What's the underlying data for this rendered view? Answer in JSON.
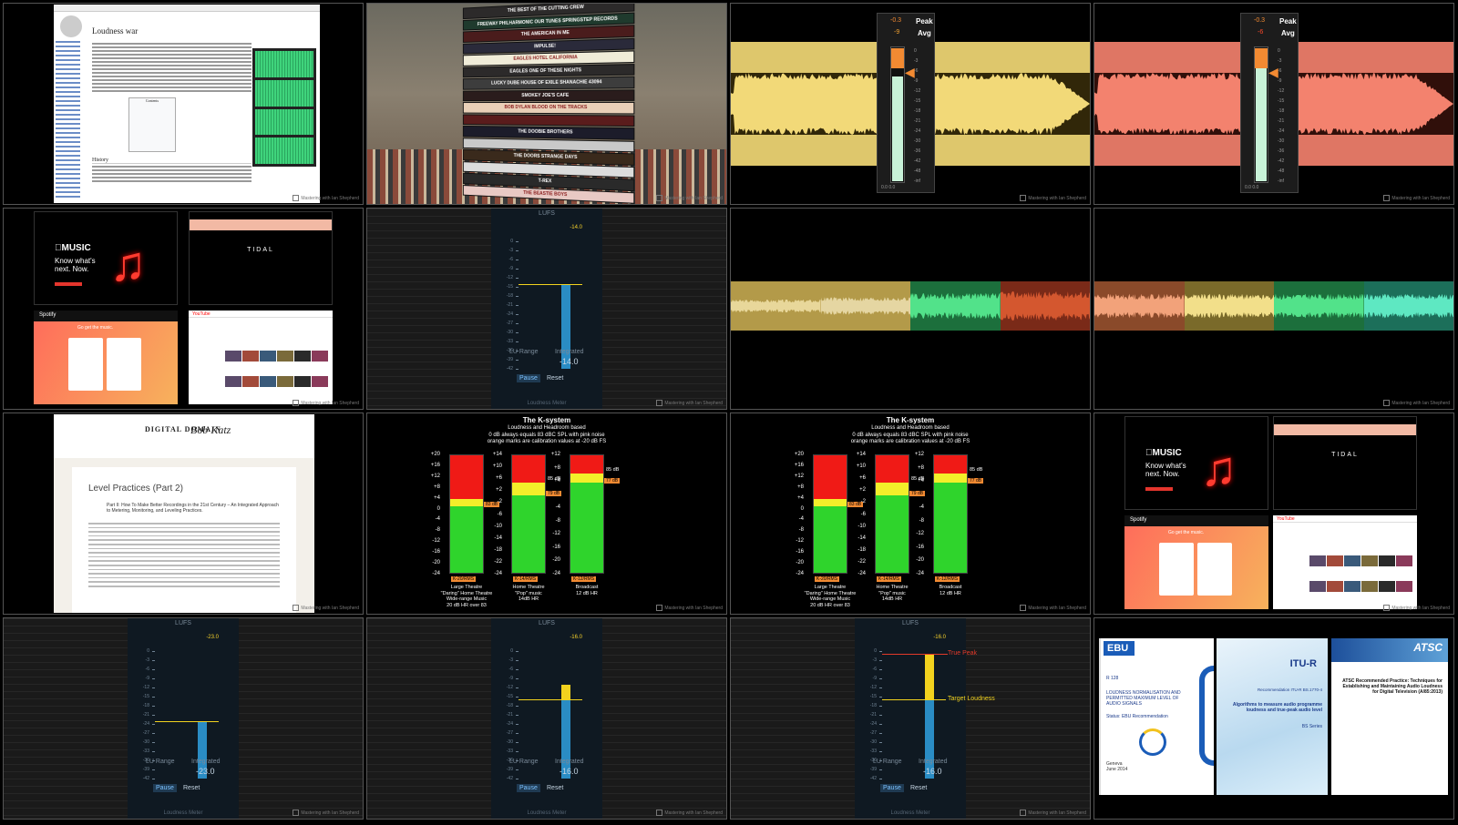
{
  "tiles": {
    "wiki": {
      "title": "Loudness war",
      "history_heading": "History",
      "contents_label": "Contents"
    },
    "cd": {
      "cases": [
        "THE BEST OF THE CUTTING CREW",
        "FREEWAY PHILHARMONIC   OUR TUNES   SPRINGSTEP RECORDS",
        "THE AMERICAN IN ME",
        "IMPULSE!",
        "EAGLES   HOTEL CALIFORNIA",
        "EAGLES   ONE OF THESE NIGHTS",
        "LUCKY DUBE   HOUSE OF EXILE   SHANACHIE 43094",
        "SMOKEY JOE'S CAFE",
        "BOB DYLAN   BLOOD ON THE TRACKS",
        "",
        "THE DOOBIE BROTHERS",
        "",
        "THE DOORS   STRANGE DAYS",
        "",
        "T-REX",
        "THE BEASTIE BOYS"
      ]
    },
    "meter_a": {
      "peak_label": "Peak",
      "avg_label": "Avg",
      "peak_value": "-0.3",
      "avg_value": "-9",
      "scale": [
        "0",
        "-3",
        "-6",
        "-9",
        "-12",
        "-15",
        "-18",
        "-21",
        "-24",
        "-30",
        "-36",
        "-42",
        "-48",
        "-inf"
      ],
      "readout": "0.0   0.0",
      "wave_color": "#f2d978",
      "wave_dark": "#8c6f1a",
      "level": 0.78
    },
    "meter_b": {
      "peak_label": "Peak",
      "avg_label": "Avg",
      "peak_value": "-0.3",
      "avg_value": "-6",
      "scale": [
        "0",
        "-3",
        "-6",
        "-9",
        "-12",
        "-15",
        "-18",
        "-21",
        "-24",
        "-30",
        "-36",
        "-42",
        "-48",
        "-inf"
      ],
      "readout": "0.0   0.0",
      "wave_color": "#f3826e",
      "wave_dark": "#8a2a1e",
      "level": 0.84
    },
    "logos": {
      "apple_line1": "MUSIC",
      "apple_line2": "Know what's next. Now.",
      "tidal": "TIDAL",
      "spotify": "Spotify",
      "spotify_tag": "Go get the music.",
      "youtube": "YouTube"
    },
    "lufs_14": {
      "title": "LUFS",
      "max": "-14.0",
      "lu_range": "LU Range",
      "integrated": "Integrated",
      "integrated_value": "-14.0",
      "pause": "Pause",
      "reset": "Reset",
      "footer": "Loudness Meter",
      "scale": [
        "0",
        "-3",
        "-6",
        "-9",
        "-12",
        "-15",
        "-18",
        "-21",
        "-24",
        "-27",
        "-30",
        "-33",
        "-36",
        "-39",
        "-42"
      ]
    },
    "lufs_23": {
      "title": "LUFS",
      "max": "-23.0",
      "lu_range": "LU Range",
      "integrated": "Integrated",
      "integrated_value": "-23.0",
      "pause": "Pause",
      "reset": "Reset",
      "footer": "Loudness Meter",
      "scale": [
        "0",
        "-3",
        "-6",
        "-9",
        "-12",
        "-15",
        "-18",
        "-21",
        "-24",
        "-27",
        "-30",
        "-33",
        "-36",
        "-39",
        "-42"
      ]
    },
    "lufs_16a": {
      "title": "LUFS",
      "max": "-16.0",
      "lu_range": "LU Range",
      "integrated": "Integrated",
      "integrated_value": "-16.0",
      "pause": "Pause",
      "reset": "Reset",
      "footer": "Loudness Meter",
      "scale": [
        "0",
        "-3",
        "-6",
        "-9",
        "-12",
        "-15",
        "-18",
        "-21",
        "-24",
        "-27",
        "-30",
        "-33",
        "-36",
        "-39",
        "-42"
      ]
    },
    "lufs_16b": {
      "title": "LUFS",
      "max": "-16.0",
      "lu_range": "LU Range",
      "integrated": "Integrated",
      "integrated_value": "-16.0",
      "pause": "Pause",
      "reset": "Reset",
      "footer": "Loudness Meter",
      "true_peak": "True Peak",
      "target": "Target Loudness",
      "scale": [
        "0",
        "-3",
        "-6",
        "-9",
        "-12",
        "-15",
        "-18",
        "-21",
        "-24",
        "-27",
        "-30",
        "-33",
        "-36",
        "-39",
        "-42"
      ]
    },
    "doc": {
      "brand": "DIGITAL DOMAIN",
      "signature": "Bob Katz",
      "heading": "Level Practices (Part 2)",
      "subheading": "Part II: How To Make Better Recordings in the 21st Century – An Integrated Approach to Metering, Monitoring, and Leveling Practices."
    },
    "ksystem": {
      "title": "The K-system",
      "line1": "Loudness and Headroom based",
      "line2": "0 dB always equals 83 dBC SPL with pink noise",
      "line3": "orange marks are calibration values at -20 dB FS",
      "scale20": [
        "+20",
        "+16",
        "+12",
        "+8",
        "+4",
        "0",
        "-4",
        "-8",
        "-12",
        "-16",
        "-20",
        "-24"
      ],
      "scale14": [
        "+14",
        "+10",
        "+6",
        "+2",
        "-2",
        "-6",
        "-10",
        "-14",
        "-18",
        "-22",
        "-24"
      ],
      "scale12": [
        "+12",
        "+8",
        "+4",
        "0",
        "-4",
        "-8",
        "-12",
        "-16",
        "-20",
        "-24"
      ],
      "meters": [
        {
          "tag": "K-20/RMS",
          "cal": "83 dB",
          "caption": [
            "Large Theatre",
            "\"Daring\" Home Theatre",
            "Wide-range Music",
            "20 dB HR over 83"
          ]
        },
        {
          "tag": "K-14/RMS",
          "cal": "79 dB",
          "top": "85 dB",
          "caption": [
            "Home Theatre",
            "\"Pop\" music",
            "14dB HR"
          ]
        },
        {
          "tag": "K-12/RMS",
          "cal": "77 dB",
          "top": "85 dB",
          "caption": [
            "Broadcast",
            "12 dB HR"
          ]
        }
      ]
    },
    "standards": {
      "ebu_logo": "EBU",
      "ebu_id": "R 128",
      "ebu_title": "LOUDNESS NORMALISATION AND PERMITTED MAXIMUM LEVEL OF AUDIO SIGNALS",
      "ebu_status": "Status: EBU Recommendation",
      "ebu_place": "Geneva",
      "ebu_date": "June 2014",
      "itu_logo": "ITU-R",
      "itu_id": "Recommendation ITU-R BS.1770-4",
      "itu_title": "Algorithms to measure audio programme loudness and true-peak audio level",
      "itu_series": "BS Series",
      "atsc_logo": "ATSC",
      "atsc_title": "ATSC Recommended Practice: Techniques for Establishing and Maintaining Audio Loudness for Digital Television (A/85:2013)"
    },
    "watermark": "Mastering with Ian Shepherd"
  }
}
